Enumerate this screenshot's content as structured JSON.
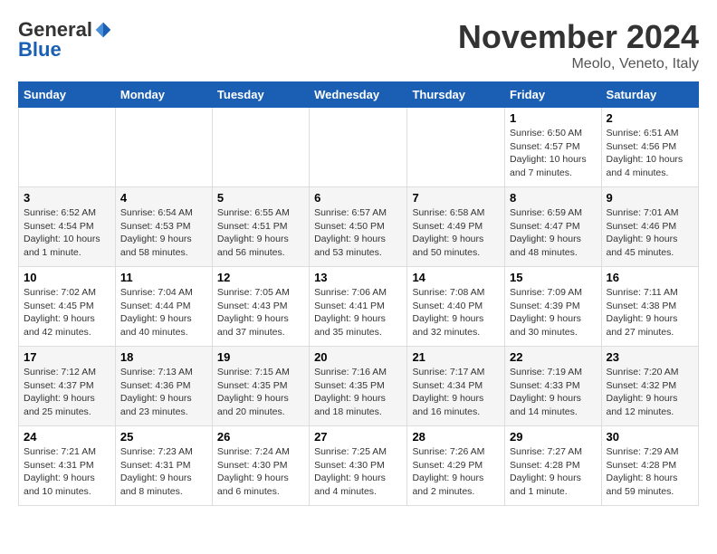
{
  "header": {
    "logo_general": "General",
    "logo_blue": "Blue",
    "month_title": "November 2024",
    "location": "Meolo, Veneto, Italy"
  },
  "calendar": {
    "days_of_week": [
      "Sunday",
      "Monday",
      "Tuesday",
      "Wednesday",
      "Thursday",
      "Friday",
      "Saturday"
    ],
    "weeks": [
      [
        {
          "day": "",
          "info": ""
        },
        {
          "day": "",
          "info": ""
        },
        {
          "day": "",
          "info": ""
        },
        {
          "day": "",
          "info": ""
        },
        {
          "day": "",
          "info": ""
        },
        {
          "day": "1",
          "info": "Sunrise: 6:50 AM\nSunset: 4:57 PM\nDaylight: 10 hours\nand 7 minutes."
        },
        {
          "day": "2",
          "info": "Sunrise: 6:51 AM\nSunset: 4:56 PM\nDaylight: 10 hours\nand 4 minutes."
        }
      ],
      [
        {
          "day": "3",
          "info": "Sunrise: 6:52 AM\nSunset: 4:54 PM\nDaylight: 10 hours\nand 1 minute."
        },
        {
          "day": "4",
          "info": "Sunrise: 6:54 AM\nSunset: 4:53 PM\nDaylight: 9 hours\nand 58 minutes."
        },
        {
          "day": "5",
          "info": "Sunrise: 6:55 AM\nSunset: 4:51 PM\nDaylight: 9 hours\nand 56 minutes."
        },
        {
          "day": "6",
          "info": "Sunrise: 6:57 AM\nSunset: 4:50 PM\nDaylight: 9 hours\nand 53 minutes."
        },
        {
          "day": "7",
          "info": "Sunrise: 6:58 AM\nSunset: 4:49 PM\nDaylight: 9 hours\nand 50 minutes."
        },
        {
          "day": "8",
          "info": "Sunrise: 6:59 AM\nSunset: 4:47 PM\nDaylight: 9 hours\nand 48 minutes."
        },
        {
          "day": "9",
          "info": "Sunrise: 7:01 AM\nSunset: 4:46 PM\nDaylight: 9 hours\nand 45 minutes."
        }
      ],
      [
        {
          "day": "10",
          "info": "Sunrise: 7:02 AM\nSunset: 4:45 PM\nDaylight: 9 hours\nand 42 minutes."
        },
        {
          "day": "11",
          "info": "Sunrise: 7:04 AM\nSunset: 4:44 PM\nDaylight: 9 hours\nand 40 minutes."
        },
        {
          "day": "12",
          "info": "Sunrise: 7:05 AM\nSunset: 4:43 PM\nDaylight: 9 hours\nand 37 minutes."
        },
        {
          "day": "13",
          "info": "Sunrise: 7:06 AM\nSunset: 4:41 PM\nDaylight: 9 hours\nand 35 minutes."
        },
        {
          "day": "14",
          "info": "Sunrise: 7:08 AM\nSunset: 4:40 PM\nDaylight: 9 hours\nand 32 minutes."
        },
        {
          "day": "15",
          "info": "Sunrise: 7:09 AM\nSunset: 4:39 PM\nDaylight: 9 hours\nand 30 minutes."
        },
        {
          "day": "16",
          "info": "Sunrise: 7:11 AM\nSunset: 4:38 PM\nDaylight: 9 hours\nand 27 minutes."
        }
      ],
      [
        {
          "day": "17",
          "info": "Sunrise: 7:12 AM\nSunset: 4:37 PM\nDaylight: 9 hours\nand 25 minutes."
        },
        {
          "day": "18",
          "info": "Sunrise: 7:13 AM\nSunset: 4:36 PM\nDaylight: 9 hours\nand 23 minutes."
        },
        {
          "day": "19",
          "info": "Sunrise: 7:15 AM\nSunset: 4:35 PM\nDaylight: 9 hours\nand 20 minutes."
        },
        {
          "day": "20",
          "info": "Sunrise: 7:16 AM\nSunset: 4:35 PM\nDaylight: 9 hours\nand 18 minutes."
        },
        {
          "day": "21",
          "info": "Sunrise: 7:17 AM\nSunset: 4:34 PM\nDaylight: 9 hours\nand 16 minutes."
        },
        {
          "day": "22",
          "info": "Sunrise: 7:19 AM\nSunset: 4:33 PM\nDaylight: 9 hours\nand 14 minutes."
        },
        {
          "day": "23",
          "info": "Sunrise: 7:20 AM\nSunset: 4:32 PM\nDaylight: 9 hours\nand 12 minutes."
        }
      ],
      [
        {
          "day": "24",
          "info": "Sunrise: 7:21 AM\nSunset: 4:31 PM\nDaylight: 9 hours\nand 10 minutes."
        },
        {
          "day": "25",
          "info": "Sunrise: 7:23 AM\nSunset: 4:31 PM\nDaylight: 9 hours\nand 8 minutes."
        },
        {
          "day": "26",
          "info": "Sunrise: 7:24 AM\nSunset: 4:30 PM\nDaylight: 9 hours\nand 6 minutes."
        },
        {
          "day": "27",
          "info": "Sunrise: 7:25 AM\nSunset: 4:30 PM\nDaylight: 9 hours\nand 4 minutes."
        },
        {
          "day": "28",
          "info": "Sunrise: 7:26 AM\nSunset: 4:29 PM\nDaylight: 9 hours\nand 2 minutes."
        },
        {
          "day": "29",
          "info": "Sunrise: 7:27 AM\nSunset: 4:28 PM\nDaylight: 9 hours\nand 1 minute."
        },
        {
          "day": "30",
          "info": "Sunrise: 7:29 AM\nSunset: 4:28 PM\nDaylight: 8 hours\nand 59 minutes."
        }
      ]
    ]
  }
}
